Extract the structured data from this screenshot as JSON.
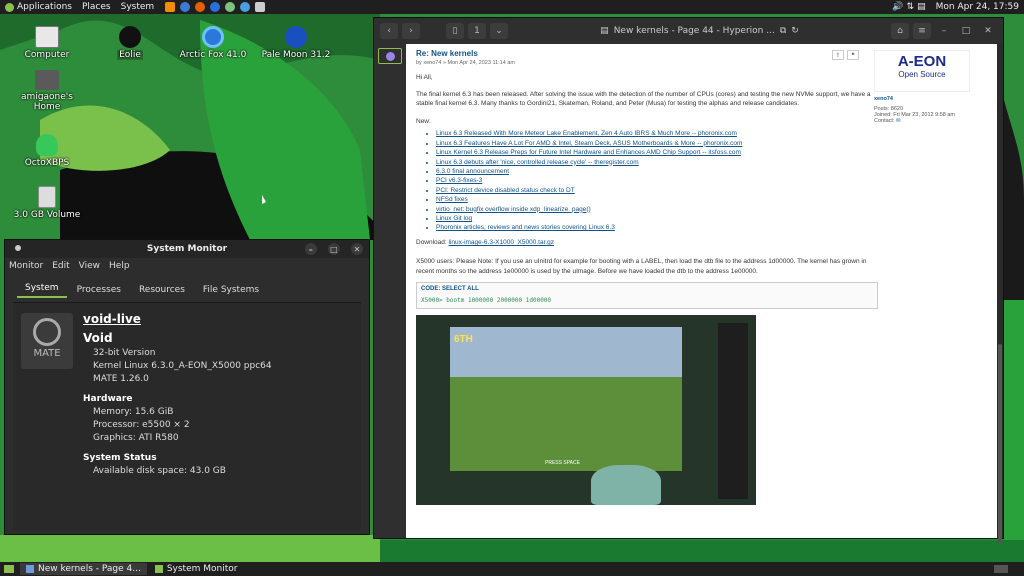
{
  "top_panel": {
    "menus": [
      "Applications",
      "Places",
      "System"
    ],
    "clock": "Mon Apr 24, 17:59"
  },
  "desktop_icons": [
    {
      "label": "Computer"
    },
    {
      "label": "Eolie"
    },
    {
      "label": "Arctic Fox 41.0"
    },
    {
      "label": "Pale Moon 31.2"
    },
    {
      "label": "amigaone's Home"
    },
    {
      "label": "OctoXBPS"
    },
    {
      "label": "3.0 GB Volume"
    }
  ],
  "sysmon": {
    "title": "System Monitor",
    "menus": [
      "Monitor",
      "Edit",
      "View",
      "Help"
    ],
    "tabs": [
      "System",
      "Processes",
      "Resources",
      "File Systems"
    ],
    "logo_text": "MATE",
    "hostname": "void-live",
    "distro": "Void",
    "release": "32-bit Version",
    "kernel": "Kernel Linux 6.3.0_A-EON_X5000 ppc64",
    "mate": "MATE 1.26.0",
    "hardware_heading": "Hardware",
    "memory_label": "Memory:",
    "memory_value": "15.6 GiB",
    "processor_label": "Processor:",
    "processor_value": "e5500 × 2",
    "graphics_label": "Graphics:",
    "graphics_value": "ATI R580",
    "status_heading": "System Status",
    "disk_label": "Available disk space:",
    "disk_value": "43.0 GB"
  },
  "browser": {
    "title": "New kernels - Page 44 - Hyperion ...",
    "post": {
      "title": "Re: New kernels",
      "byline": "by xeno74 » Mon Apr 24, 2023 11:14 am",
      "greeting": "Hi All,",
      "body1": "The final kernel 6.3 has been released. After solving the issue with the detection of the number of CPUs (cores) and testing the new NVMe support, we have a stable final kernel 6.3. Many thanks to Gordini21, Skateman, Roland, and Peter (Musa) for testing the alphas and release candidates.",
      "new_label": "New:",
      "links": [
        "Linux 6.3 Released With More Meteor Lake Enablement, Zen 4 Auto IBRS & Much More -- phoronix.com",
        "Linux 6.3 Features Have A Lot For AMD & Intel, Steam Deck, ASUS Motherboards & More -- phoronix.com",
        "Linux Kernel 6.3 Release Preps for Future Intel Hardware and Enhances AMD Chip Support -- itsfoss.com",
        "Linux 6.3 debuts after 'nice, controlled release cycle' -- theregister.com",
        "6.3.0 final announcement",
        "PCI v6.3-fixes-3",
        "PCI: Restrict device disabled status check to DT",
        "NFSd fixes",
        "virtio_net: bugfix overflow inside xdp_linearize_page()",
        "Linux Git log",
        "Phoronix articles, reviews and news stories covering Linux 6.3"
      ],
      "download_label": "Download:",
      "download_link": "linux-image-6.3-X1000_X5000.tar.gz",
      "note": "X5000 users: Please Note: If you use an uInitrd for example for booting with a LABEL, then load the dtb file to the address 1d00000. The kernel has grown in recent months so the address 1e00000 is used by the uImage. Before we have loaded the dtb to the address 1e00000.",
      "code_label": "CODE: SELECT ALL",
      "code": "X5000> bootm 1000000 2000000 1d00000"
    },
    "profile": {
      "logo_main": "A-EON",
      "logo_sub": "Open Source",
      "user": "xeno74",
      "posts": "Posts: 8620",
      "joined": "Joined: Fri Mar 23, 2012 9:58 am",
      "contact": "Contact:"
    },
    "screenshot": {
      "hud": "6TH",
      "caption": "PRESS SPACE"
    }
  },
  "taskbar": {
    "tasks": [
      "New kernels - Page 4...",
      "System Monitor"
    ]
  },
  "colors": {
    "accent": "#8cc04e",
    "link": "#105289",
    "desktop_green": "#2f8a3c"
  }
}
